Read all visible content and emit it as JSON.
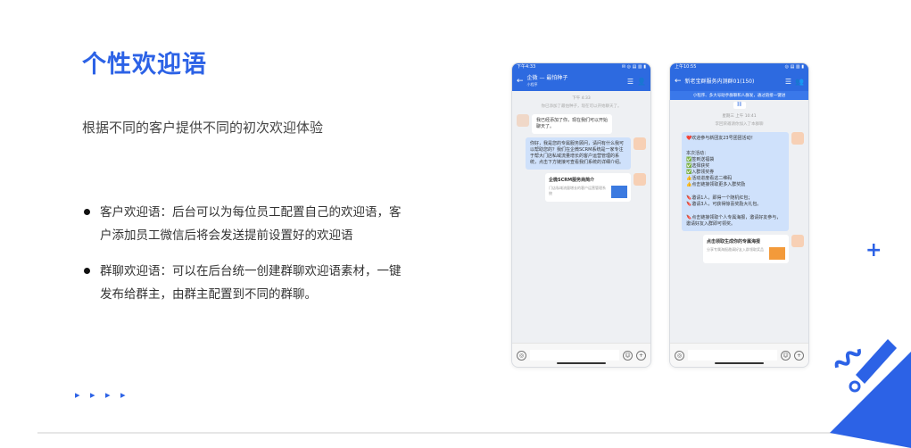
{
  "title": "个性欢迎语",
  "subtitle": "根据不同的客户提供不同的初次欢迎体验",
  "bullets": [
    "客户欢迎语：后台可以为每位员工配置自己的欢迎语，客户添加员工微信后将会发送提前设置好的欢迎语",
    "群聊欢迎语：可以在后台统一创建群聊欢迎语素材，一键发布给群主，由群主配置到不同的群聊。"
  ],
  "arrows": "▸ ▸ ▸ ▸",
  "phone1": {
    "status_time": "下午4:33",
    "status_icons": "✉ ◎ ▤ ▥ ▮",
    "header_title": "企微 — 最怕种子",
    "header_sub": "小程序",
    "time": "下午 4:33",
    "system_msg": "你已添加了最怕种子，现在可以开始聊天了。",
    "msg1": "我已经添加了你，现在我们可以开始聊天了。",
    "msg2": "你好，我是您的专属服务顾问，请问有什么我可以帮助您的？我们在企微SCRM系统是一家专注于帮大门店私域流量增长的客户运营管理的系统，点击下方链接可查看我们系统的详细介绍。",
    "card_title": "企微SCRM服务商简介",
    "card_desc": "门店私域流量增长的客户运营管理系统"
  },
  "phone2": {
    "status_time": "上午10:55",
    "status_icons": "◎ ▤ ▥ ▮",
    "header_title": "新老宝群服务内测群01(150)",
    "notice": "小程序、多大号助手群聊和人群发，通过链接一键进",
    "time": "星期三 上午 10:41",
    "system_msg": "李回荣邀请你加入了本群聊",
    "msg_intro": "❤️欢迎参与新团友23号团团活动！",
    "msg_rules_title": "本次活动：",
    "rule1": "✅签到送福袋",
    "rule2": "✅选择获奖",
    "rule3": "✅入群领奖券",
    "rule4": "👍活动进度看这二维码",
    "rule5": "👍点击链接领取更多入群奖励",
    "msg_extra1": "🔖邀请1人，即得一个随机红包；",
    "msg_extra2": "🔖邀请3人，可获得惊喜奖励大礼包。",
    "msg_extra3": "🔖点击链接领取个人专属海报，邀请好友参与，邀请好友入群即可领奖。",
    "card_title": "点击领取生成你的专属海报",
    "card_desc": "分享专属海报邀请好友入群领取奖品"
  },
  "colors": {
    "accent": "#2c62e6",
    "chat_blue": "#cfe1fb"
  }
}
